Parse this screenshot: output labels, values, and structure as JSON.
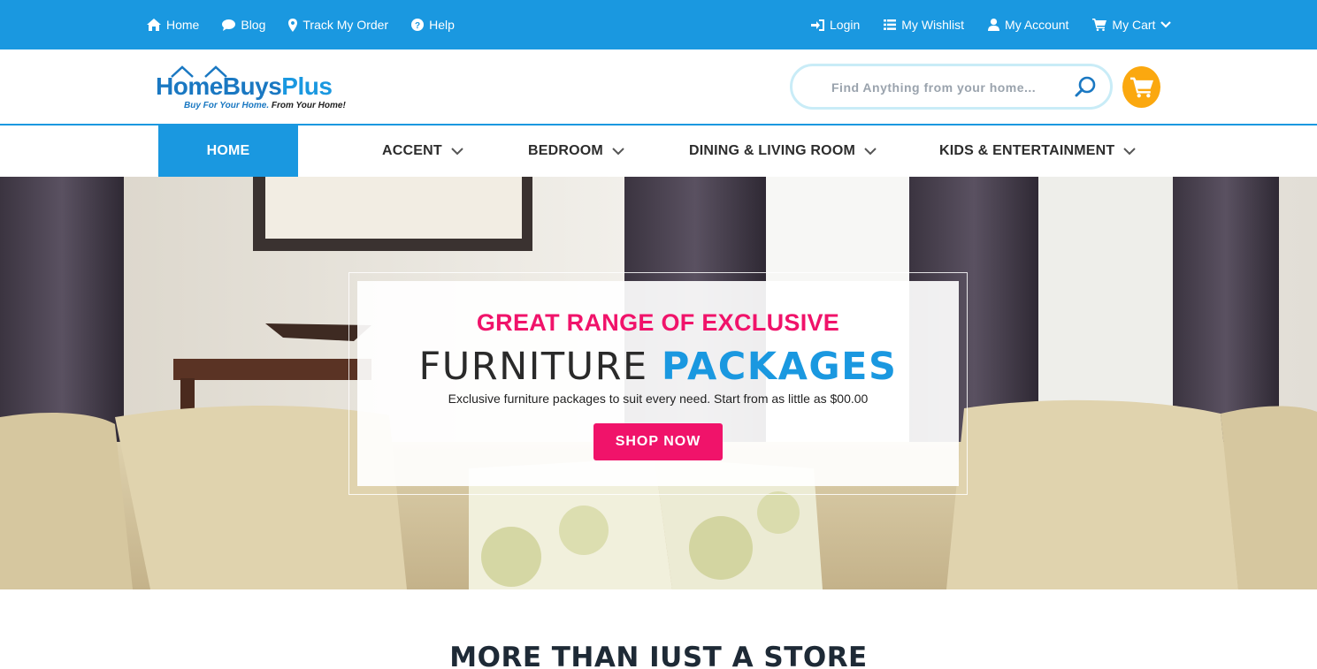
{
  "topbar": {
    "left_links": [
      {
        "label": "Home",
        "icon": "home-icon"
      },
      {
        "label": "Blog",
        "icon": "chat-bubble-icon"
      },
      {
        "label": "Track My Order",
        "icon": "map-pin-icon"
      },
      {
        "label": "Help",
        "icon": "question-circle-icon"
      }
    ],
    "right_links": [
      {
        "label": "Login",
        "icon": "sign-in-icon"
      },
      {
        "label": "My Wishlist",
        "icon": "list-icon"
      },
      {
        "label": "My Account",
        "icon": "user-icon"
      },
      {
        "label": "My Cart",
        "icon": "cart-icon"
      }
    ]
  },
  "header": {
    "logo": {
      "brand_part1": "HomeBuys",
      "brand_part2": "Plus",
      "tagline_part1": "Buy For Your Home.",
      "tagline_part2": " From Your Home!"
    },
    "search": {
      "placeholder": "Find Anything from your home...",
      "value": ""
    }
  },
  "nav": {
    "items": [
      {
        "label": "HOME",
        "active": true
      },
      {
        "label": "ACCENT",
        "has_dropdown": true
      },
      {
        "label": "BEDROOM",
        "has_dropdown": true
      },
      {
        "label": "DINING & LIVING ROOM",
        "has_dropdown": true
      },
      {
        "label": "KIDS & ENTERTAINMENT",
        "has_dropdown": true
      }
    ]
  },
  "hero": {
    "kicker": "GREAT RANGE OF EXCLUSIVE",
    "title_part1": "FURNITURE ",
    "title_part2": "PACKAGES",
    "subtitle": "Exclusive furniture packages to suit every need. Start from as little as $00.00",
    "cta_label": "SHOP NOW"
  },
  "section": {
    "title": "MORE THAN IUST A STORE"
  },
  "colors": {
    "primary": "#1a98e0",
    "accent_pink": "#f0136a",
    "cart_orange": "#fba80f",
    "dark_text": "#1e2a36"
  }
}
